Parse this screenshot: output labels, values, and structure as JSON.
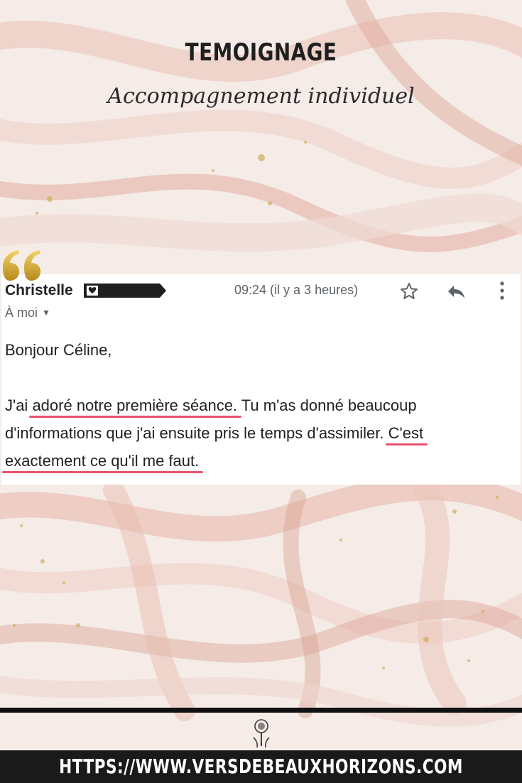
{
  "header": {
    "title": "TEMOIGNAGE",
    "subtitle": "Accompagnement individuel"
  },
  "email": {
    "sender": "Christelle",
    "timestamp": "09:24 (il y a 3 heures)",
    "recipient": "À moi",
    "greeting": "Bonjour Céline,",
    "body": {
      "p1": "J'ai ",
      "h1": "adoré notre première séance.",
      "p2": " Tu m'as donné beaucoup",
      "p3": "d'informations que j'ai ensuite pris le temps d'assimiler. ",
      "h2": "C'est",
      "h3": "exactement ce qu'il me faut."
    },
    "icons": [
      "star-icon",
      "reply-icon",
      "more-vert-icon",
      "heart-icon"
    ]
  },
  "footer": {
    "url": "HTTPS://WWW.VERSDEBEAUXHORIZONS.COM"
  },
  "colors": {
    "highlight": "#e8536f",
    "gold": "#c9a227",
    "marble_pink": "#e6b3a3"
  }
}
